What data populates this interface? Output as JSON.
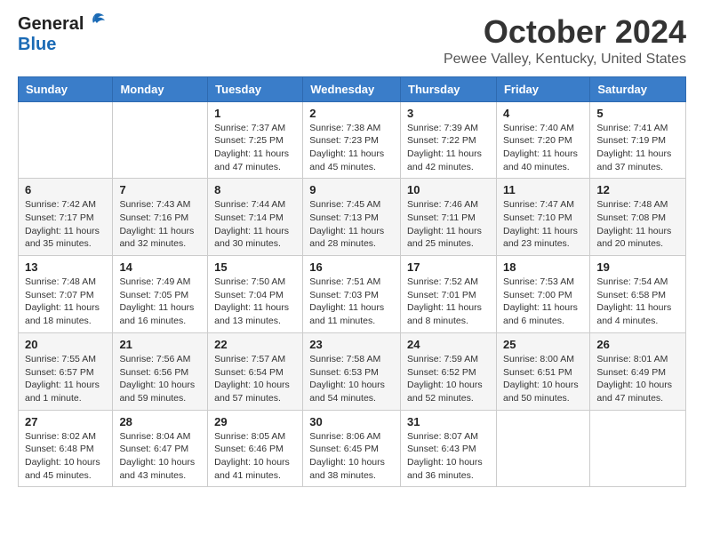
{
  "header": {
    "logo_general": "General",
    "logo_blue": "Blue",
    "title": "October 2024",
    "subtitle": "Pewee Valley, Kentucky, United States"
  },
  "weekdays": [
    "Sunday",
    "Monday",
    "Tuesday",
    "Wednesday",
    "Thursday",
    "Friday",
    "Saturday"
  ],
  "weeks": [
    [
      {
        "day": "",
        "info": ""
      },
      {
        "day": "",
        "info": ""
      },
      {
        "day": "1",
        "info": "Sunrise: 7:37 AM\nSunset: 7:25 PM\nDaylight: 11 hours and 47 minutes."
      },
      {
        "day": "2",
        "info": "Sunrise: 7:38 AM\nSunset: 7:23 PM\nDaylight: 11 hours and 45 minutes."
      },
      {
        "day": "3",
        "info": "Sunrise: 7:39 AM\nSunset: 7:22 PM\nDaylight: 11 hours and 42 minutes."
      },
      {
        "day": "4",
        "info": "Sunrise: 7:40 AM\nSunset: 7:20 PM\nDaylight: 11 hours and 40 minutes."
      },
      {
        "day": "5",
        "info": "Sunrise: 7:41 AM\nSunset: 7:19 PM\nDaylight: 11 hours and 37 minutes."
      }
    ],
    [
      {
        "day": "6",
        "info": "Sunrise: 7:42 AM\nSunset: 7:17 PM\nDaylight: 11 hours and 35 minutes."
      },
      {
        "day": "7",
        "info": "Sunrise: 7:43 AM\nSunset: 7:16 PM\nDaylight: 11 hours and 32 minutes."
      },
      {
        "day": "8",
        "info": "Sunrise: 7:44 AM\nSunset: 7:14 PM\nDaylight: 11 hours and 30 minutes."
      },
      {
        "day": "9",
        "info": "Sunrise: 7:45 AM\nSunset: 7:13 PM\nDaylight: 11 hours and 28 minutes."
      },
      {
        "day": "10",
        "info": "Sunrise: 7:46 AM\nSunset: 7:11 PM\nDaylight: 11 hours and 25 minutes."
      },
      {
        "day": "11",
        "info": "Sunrise: 7:47 AM\nSunset: 7:10 PM\nDaylight: 11 hours and 23 minutes."
      },
      {
        "day": "12",
        "info": "Sunrise: 7:48 AM\nSunset: 7:08 PM\nDaylight: 11 hours and 20 minutes."
      }
    ],
    [
      {
        "day": "13",
        "info": "Sunrise: 7:48 AM\nSunset: 7:07 PM\nDaylight: 11 hours and 18 minutes."
      },
      {
        "day": "14",
        "info": "Sunrise: 7:49 AM\nSunset: 7:05 PM\nDaylight: 11 hours and 16 minutes."
      },
      {
        "day": "15",
        "info": "Sunrise: 7:50 AM\nSunset: 7:04 PM\nDaylight: 11 hours and 13 minutes."
      },
      {
        "day": "16",
        "info": "Sunrise: 7:51 AM\nSunset: 7:03 PM\nDaylight: 11 hours and 11 minutes."
      },
      {
        "day": "17",
        "info": "Sunrise: 7:52 AM\nSunset: 7:01 PM\nDaylight: 11 hours and 8 minutes."
      },
      {
        "day": "18",
        "info": "Sunrise: 7:53 AM\nSunset: 7:00 PM\nDaylight: 11 hours and 6 minutes."
      },
      {
        "day": "19",
        "info": "Sunrise: 7:54 AM\nSunset: 6:58 PM\nDaylight: 11 hours and 4 minutes."
      }
    ],
    [
      {
        "day": "20",
        "info": "Sunrise: 7:55 AM\nSunset: 6:57 PM\nDaylight: 11 hours and 1 minute."
      },
      {
        "day": "21",
        "info": "Sunrise: 7:56 AM\nSunset: 6:56 PM\nDaylight: 10 hours and 59 minutes."
      },
      {
        "day": "22",
        "info": "Sunrise: 7:57 AM\nSunset: 6:54 PM\nDaylight: 10 hours and 57 minutes."
      },
      {
        "day": "23",
        "info": "Sunrise: 7:58 AM\nSunset: 6:53 PM\nDaylight: 10 hours and 54 minutes."
      },
      {
        "day": "24",
        "info": "Sunrise: 7:59 AM\nSunset: 6:52 PM\nDaylight: 10 hours and 52 minutes."
      },
      {
        "day": "25",
        "info": "Sunrise: 8:00 AM\nSunset: 6:51 PM\nDaylight: 10 hours and 50 minutes."
      },
      {
        "day": "26",
        "info": "Sunrise: 8:01 AM\nSunset: 6:49 PM\nDaylight: 10 hours and 47 minutes."
      }
    ],
    [
      {
        "day": "27",
        "info": "Sunrise: 8:02 AM\nSunset: 6:48 PM\nDaylight: 10 hours and 45 minutes."
      },
      {
        "day": "28",
        "info": "Sunrise: 8:04 AM\nSunset: 6:47 PM\nDaylight: 10 hours and 43 minutes."
      },
      {
        "day": "29",
        "info": "Sunrise: 8:05 AM\nSunset: 6:46 PM\nDaylight: 10 hours and 41 minutes."
      },
      {
        "day": "30",
        "info": "Sunrise: 8:06 AM\nSunset: 6:45 PM\nDaylight: 10 hours and 38 minutes."
      },
      {
        "day": "31",
        "info": "Sunrise: 8:07 AM\nSunset: 6:43 PM\nDaylight: 10 hours and 36 minutes."
      },
      {
        "day": "",
        "info": ""
      },
      {
        "day": "",
        "info": ""
      }
    ]
  ]
}
